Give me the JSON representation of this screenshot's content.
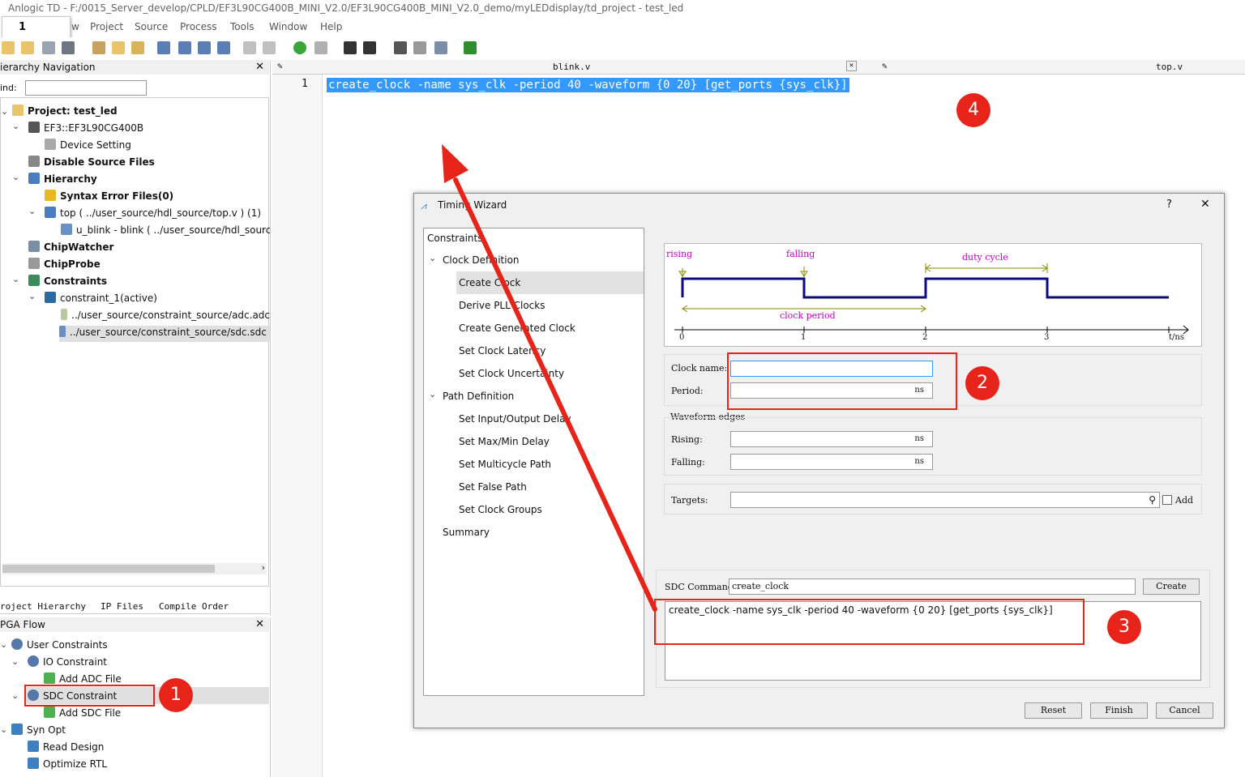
{
  "window": {
    "title": "Anlogic TD - F:/0015_Server_develop/CPLD/EF3L90CG400B_MINI_V2.0/EF3L90CG400B_MINI_V2.0_demo/myLEDdisplay/td_project - test_led"
  },
  "popup": {
    "value": "1"
  },
  "menu": [
    "w",
    "Project",
    "Source",
    "Process",
    "Tools",
    "Window",
    "Help"
  ],
  "hierarchy": {
    "title": "ierarchy Navigation",
    "find_label": "ind:",
    "items": [
      {
        "label": "Project: test_led"
      },
      {
        "label": "EF3::EF3L90CG400B"
      },
      {
        "label": "Device Setting"
      },
      {
        "label": "Disable Source Files"
      },
      {
        "label": "Hierarchy"
      },
      {
        "label": "Syntax Error Files(0)"
      },
      {
        "label": "top ( ../user_source/hdl_source/top.v )  (1)"
      },
      {
        "label": "u_blink - blink ( ../user_source/hdl_source"
      },
      {
        "label": "ChipWatcher"
      },
      {
        "label": "ChipProbe"
      },
      {
        "label": "Constraints"
      },
      {
        "label": "constraint_1(active)"
      },
      {
        "label": "../user_source/constraint_source/adc.adc"
      },
      {
        "label": "../user_source/constraint_source/sdc.sdc"
      }
    ],
    "tabs": [
      "roject Hierarchy",
      "IP Files",
      "Compile Order"
    ]
  },
  "flow": {
    "title": "PGA Flow",
    "items": [
      {
        "label": "User Constraints"
      },
      {
        "label": "IO Constraint"
      },
      {
        "label": "Add ADC File"
      },
      {
        "label": "SDC Constraint"
      },
      {
        "label": "Add SDC File"
      },
      {
        "label": "Syn Opt"
      },
      {
        "label": "Read Design"
      },
      {
        "label": "Optimize RTL"
      }
    ]
  },
  "editor": {
    "tabs": [
      "blink.v",
      "top.v"
    ],
    "line_number": "1",
    "code": "create_clock -name sys_clk -period 40 -waveform {0 20} [get_ports {sys_clk}]"
  },
  "dialog": {
    "title": "Timing Wizard",
    "help": "?",
    "close": "✕",
    "nav": {
      "root": "Constraints",
      "clock_group": "Clock Definition",
      "clock_items": [
        "Create Clock",
        "Derive PLL Clocks",
        "Create Generated Clock",
        "Set Clock Latency",
        "Set Clock Uncertainty"
      ],
      "path_group": "Path Definition",
      "path_items": [
        "Set Input/Output Delay",
        "Set Max/Min Delay",
        "Set Multicycle Path",
        "Set False Path",
        "Set Clock Groups"
      ],
      "summary": "Summary"
    },
    "waveform": {
      "rising": "rising",
      "falling": "falling",
      "duty_cycle": "duty cycle",
      "clock_period": "clock period",
      "ticks": [
        "0",
        "1",
        "2",
        "3"
      ],
      "axis": "t/ns"
    },
    "form": {
      "clock_name_label": "Clock name:",
      "clock_name_value": "",
      "period_label": "Period:",
      "period_unit": "ns",
      "waveform_group": "Waveform edges",
      "rising_label": "Rising:",
      "rising_unit": "ns",
      "falling_label": "Falling:",
      "falling_unit": "ns",
      "targets_label": "Targets:",
      "add_label": "Add"
    },
    "sdc": {
      "label": "SDC Command:",
      "value": "create_clock",
      "create_button": "Create",
      "output": "create_clock -name sys_clk -period 40 -waveform {0 20} [get_ports {sys_clk}]"
    },
    "buttons": {
      "reset": "Reset",
      "finish": "Finish",
      "cancel": "Cancel"
    }
  },
  "annotations": [
    "1",
    "2",
    "3",
    "4"
  ],
  "colors": {
    "accent": "#e8231a",
    "selection": "#3399ff",
    "wave": "#0a0a82",
    "wave_label": "#c000c0",
    "dim_line": "#8a8a00"
  }
}
